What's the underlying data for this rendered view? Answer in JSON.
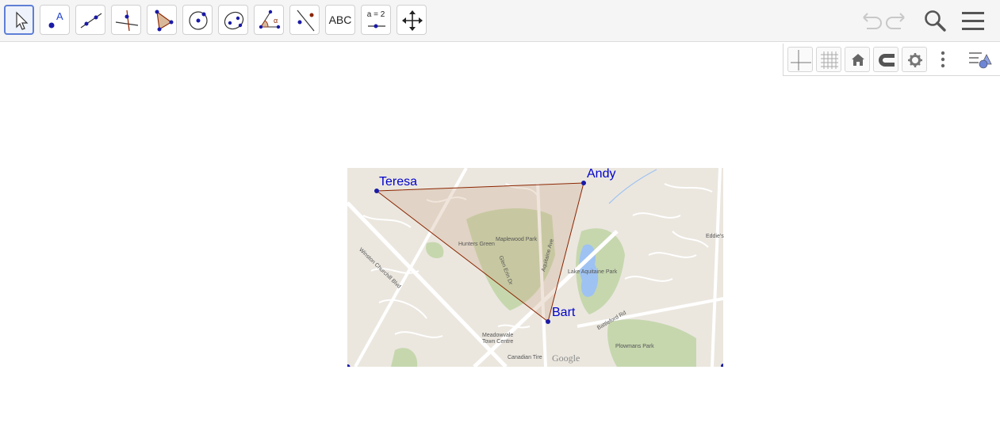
{
  "toolbar": {
    "tools": [
      {
        "name": "move-tool",
        "label": ""
      },
      {
        "name": "point-tool",
        "label": "A"
      },
      {
        "name": "line-tool",
        "label": ""
      },
      {
        "name": "perpendicular-tool",
        "label": ""
      },
      {
        "name": "polygon-tool",
        "label": ""
      },
      {
        "name": "circle-tool",
        "label": ""
      },
      {
        "name": "ellipse-tool",
        "label": ""
      },
      {
        "name": "angle-tool",
        "label": "α"
      },
      {
        "name": "reflect-tool",
        "label": ""
      },
      {
        "name": "text-tool",
        "label": "ABC"
      },
      {
        "name": "slider-tool",
        "label": "a = 2"
      },
      {
        "name": "move-graphics-tool",
        "label": ""
      }
    ],
    "right_icons": [
      "undo-icon",
      "redo-icon",
      "search-icon",
      "menu-icon"
    ]
  },
  "style_bar": {
    "icons": [
      "axes-icon",
      "grid-icon",
      "home-icon",
      "magnet-icon",
      "gear-icon",
      "more-icon",
      "style-bar-toggle-icon"
    ]
  },
  "points": {
    "teresa": "Teresa",
    "andy": "Andy",
    "bart": "Bart"
  },
  "map": {
    "attribution": "Google",
    "labels": {
      "hunters_green": "Hunters Green",
      "maplewood_park": "Maplewood Park",
      "lake_aquitaine_park": "Lake Aquitaine Park",
      "meadowvale_town_centre": "Meadowvale Town Centre",
      "canadian_tire": "Canadian Tire",
      "plowmans_park": "Plowmans Park",
      "winston_churchill_blvd": "Winston Churchill Blvd",
      "glen_erin_dr": "Glen Erin Dr",
      "aquitaine_ave": "Aquitaine Ave",
      "battleford_rd": "Battleford Rd",
      "eddies": "Eddie's"
    }
  },
  "colors": {
    "point": "#1a1aa6",
    "label": "#0000cc",
    "triangle_stroke": "#8b2500",
    "triangle_fill": "#c8a080",
    "toolbar_active_border": "#5f7fd6"
  }
}
